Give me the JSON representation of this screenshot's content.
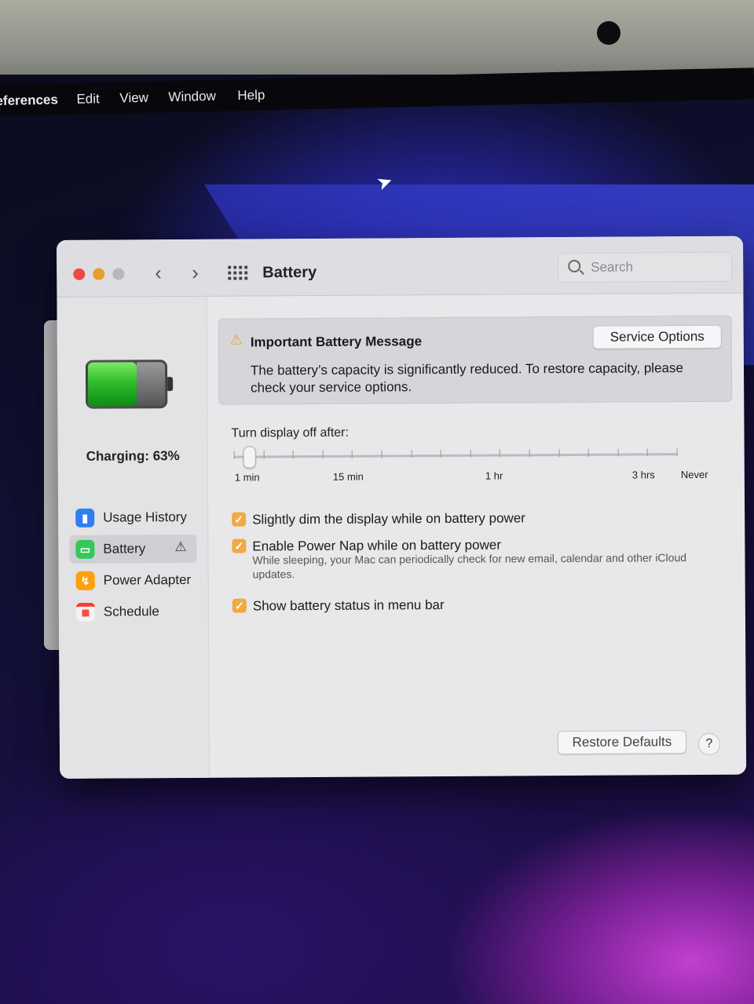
{
  "menubar": {
    "items": [
      "eferences",
      "Edit",
      "View",
      "Window",
      "Help"
    ]
  },
  "window": {
    "title": "Battery",
    "search_placeholder": "Search"
  },
  "sidebar": {
    "status": "Charging: 63%",
    "battery_level": 0.63,
    "items": [
      {
        "label": "Usage History",
        "icon": "usage-history-icon",
        "color": "#2f7ff2"
      },
      {
        "label": "Battery",
        "icon": "battery-icon",
        "color": "#34c759",
        "active": true,
        "warning": true
      },
      {
        "label": "Power Adapter",
        "icon": "power-adapter-icon",
        "color": "#ff9f0a"
      },
      {
        "label": "Schedule",
        "icon": "calendar-icon",
        "color": "#ff3b30"
      }
    ]
  },
  "message": {
    "title": "Important Battery Message",
    "body": "The battery’s capacity is significantly reduced. To restore capacity, please check your service options.",
    "button": "Service Options"
  },
  "slider": {
    "label": "Turn display off after:",
    "ticks": [
      "1 min",
      "15 min",
      "1 hr",
      "3 hrs",
      "Never"
    ],
    "value": "2 min"
  },
  "options": [
    {
      "label": "Slightly dim the display while on battery power",
      "checked": true
    },
    {
      "label": "Enable Power Nap while on battery power",
      "checked": true
    },
    {
      "label": "Show battery status in menu bar",
      "checked": true
    }
  ],
  "power_nap_note": "While sleeping, your Mac can periodically check for new email, calendar and other iCloud updates.",
  "footer": {
    "restore": "Restore Defaults",
    "help": "?"
  }
}
